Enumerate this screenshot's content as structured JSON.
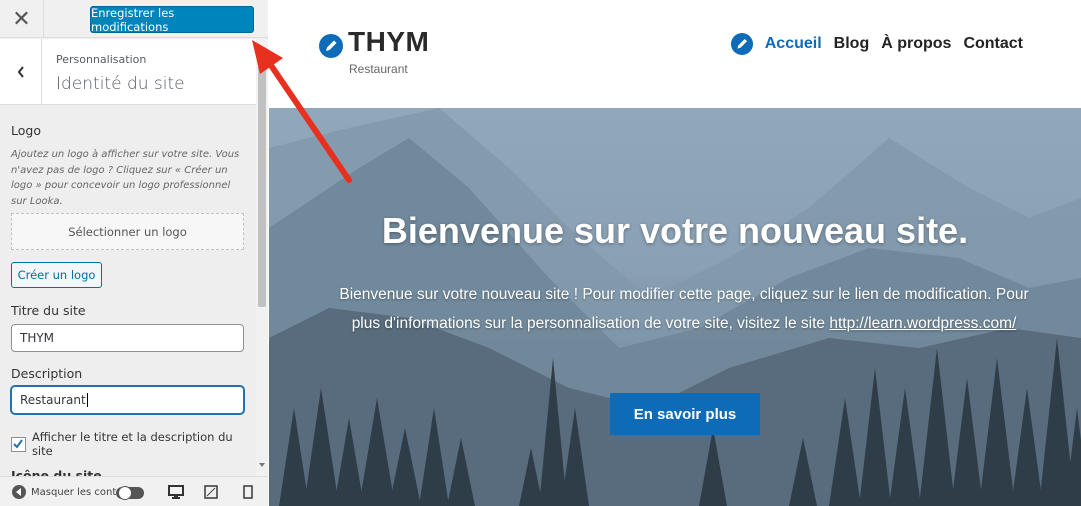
{
  "sidebar": {
    "close_glyph": "✕",
    "save_label": "Enregistrer les modifications",
    "breadcrumb": "Personnalisation",
    "section_title": "Identité du site",
    "logo": {
      "label": "Logo",
      "description": "Ajoutez un logo à afficher sur votre site. Vous n'avez pas de logo ? Cliquez sur « Créer un logo » pour concevoir un logo professionnel sur Looka.",
      "select_label": "Sélectionner un logo",
      "create_label": "Créer un logo"
    },
    "site_title": {
      "label": "Titre du site",
      "value": "THYM"
    },
    "description": {
      "label": "Description",
      "value": "Restaurant"
    },
    "display_title_checkbox": {
      "label": "Afficher le titre et la description du site",
      "checked": true
    },
    "next_section_partial": "Icône du site",
    "footer": {
      "hide_controls_label": "Masquer les contrôles"
    }
  },
  "preview": {
    "site_name": "THYM",
    "site_description": "Restaurant",
    "nav": [
      "Accueil",
      "Blog",
      "À propos",
      "Contact"
    ],
    "nav_active": "Accueil",
    "hero": {
      "title": "Bienvenue sur votre nouveau site.",
      "text_before_link": "Bienvenue sur votre nouveau site ! Pour modifier cette page, cliquez sur le lien de modification. Pour plus d'informations sur la personnalisation de votre site, visitez le site ",
      "link": "http://learn.wordpress.com/",
      "button": "En savoir plus"
    }
  },
  "colors": {
    "accent_blue": "#0d6bb8",
    "save_button": "#0085ba",
    "annotation_arrow": "#e8301f"
  }
}
